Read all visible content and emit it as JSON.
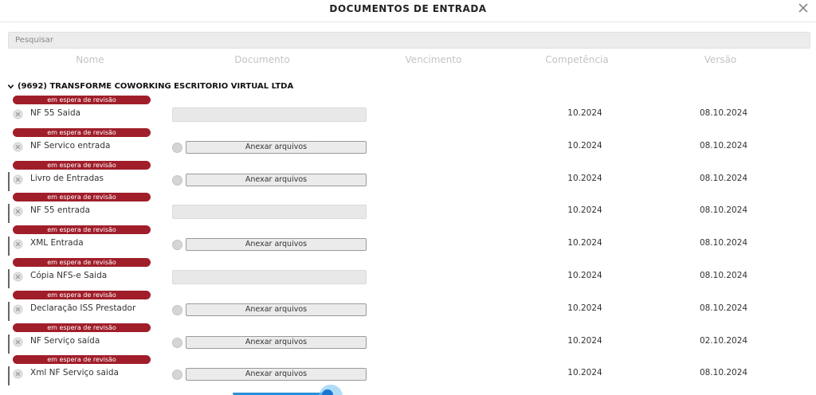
{
  "dialog": {
    "title": "DOCUMENTOS DE ENTRADA",
    "close_icon": "close-icon"
  },
  "search": {
    "placeholder": "Pesquisar"
  },
  "columns": [
    "Nome",
    "Documento",
    "Vencimento",
    "Competência",
    "Versão"
  ],
  "group": {
    "label": "(9692) TRANSFORME COWORKING ESCRITORIO VIRTUAL LTDA",
    "expanded_icon": "chevron-down-icon"
  },
  "colors": {
    "badge": "#a01e2a",
    "accent": "#1976d2"
  },
  "rows": [
    {
      "status": "em espera de revisão",
      "name": "NF 55 Saida",
      "document": "empty",
      "attach_label": "",
      "competencia": "10.2024",
      "versao": "08.10.2024",
      "left_bar": false
    },
    {
      "status": "em espera de revisão",
      "name": "NF Servico entrada",
      "document": "attach",
      "attach_label": "Anexar arquivos",
      "competencia": "10.2024",
      "versao": "08.10.2024",
      "left_bar": false
    },
    {
      "status": "em espera de revisão",
      "name": "Livro de Entradas",
      "document": "attach",
      "attach_label": "Anexar arquivos",
      "competencia": "10.2024",
      "versao": "08.10.2024",
      "left_bar": true
    },
    {
      "status": "em espera de revisão",
      "name": "NF 55 entrada",
      "document": "empty",
      "attach_label": "",
      "competencia": "10.2024",
      "versao": "08.10.2024",
      "left_bar": true
    },
    {
      "status": "em espera de revisão",
      "name": "XML Entrada",
      "document": "attach",
      "attach_label": "Anexar arquivos",
      "competencia": "10.2024",
      "versao": "08.10.2024",
      "left_bar": true
    },
    {
      "status": "em espera de revisão",
      "name": "Cópia NFS-e Saida",
      "document": "empty",
      "attach_label": "",
      "competencia": "10.2024",
      "versao": "08.10.2024",
      "left_bar": true
    },
    {
      "status": "em espera de revisão",
      "name": "Declaração ISS Prestador",
      "document": "attach",
      "attach_label": "Anexar arquivos",
      "competencia": "10.2024",
      "versao": "08.10.2024",
      "left_bar": true
    },
    {
      "status": "em espera de revisão",
      "name": "NF Serviço saída",
      "document": "attach",
      "attach_label": "Anexar arquivos",
      "competencia": "10.2024",
      "versao": "02.10.2024",
      "left_bar": true
    },
    {
      "status": "em espera de revisão",
      "name": "Xml NF Serviço saida",
      "document": "attach",
      "attach_label": "Anexar arquivos",
      "competencia": "10.2024",
      "versao": "08.10.2024",
      "left_bar": true
    }
  ]
}
